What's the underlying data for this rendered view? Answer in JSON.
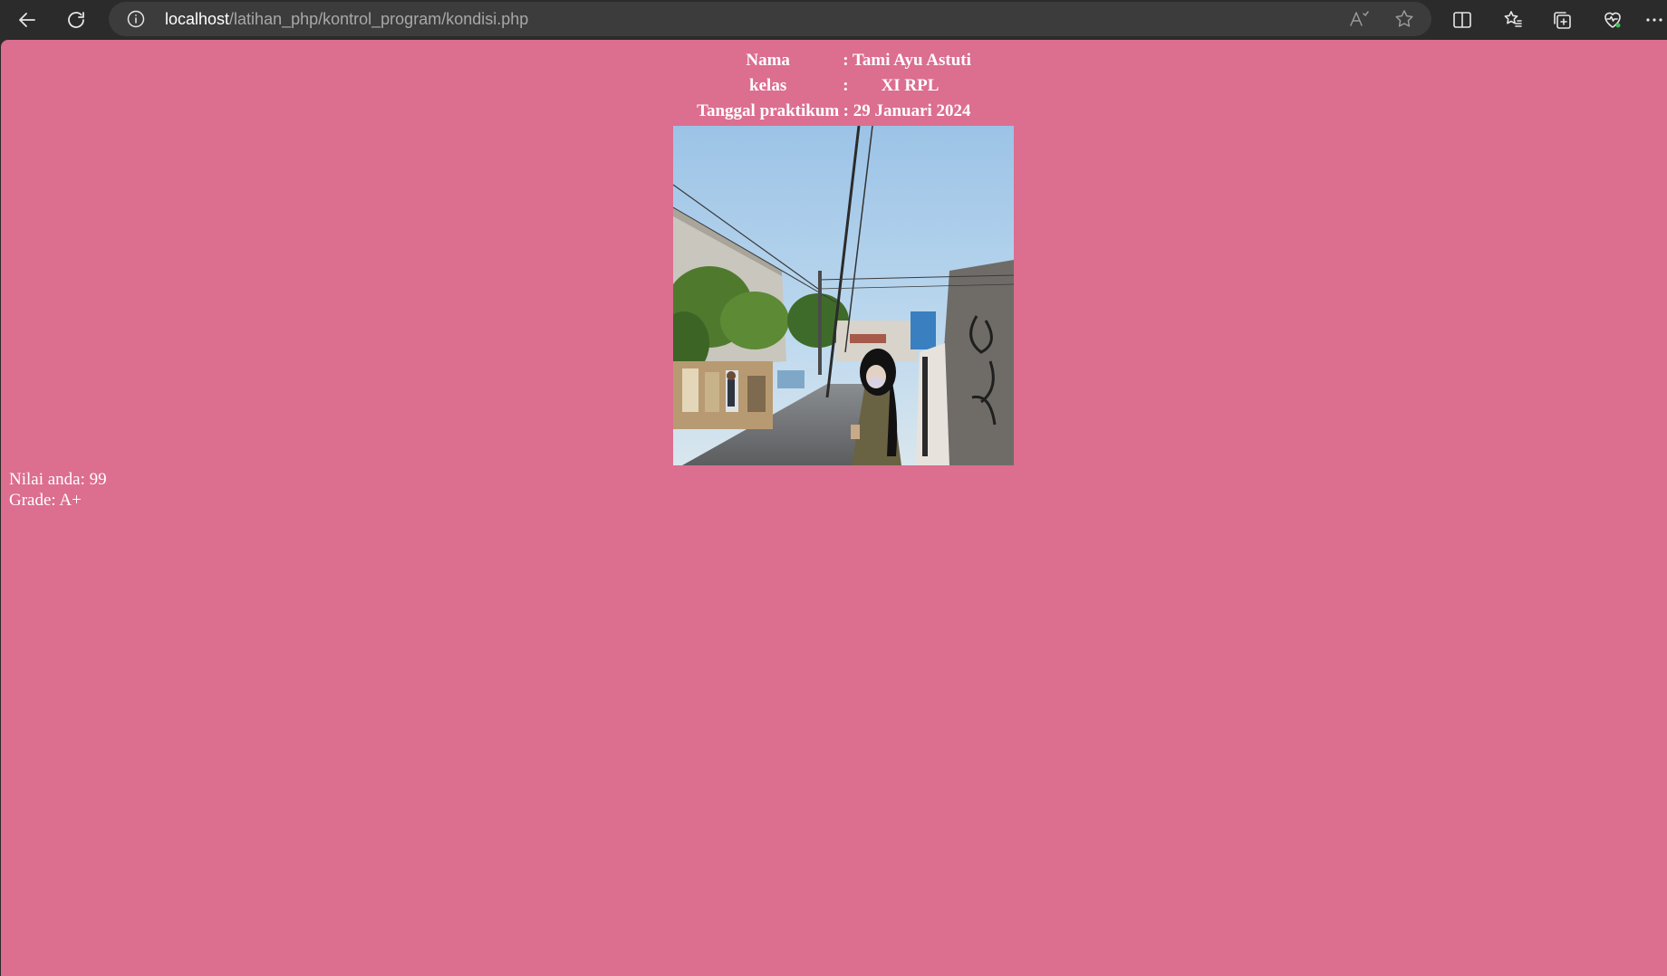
{
  "browser": {
    "url_host": "localhost",
    "url_path": "/latihan_php/kontrol_program/kondisi.php",
    "icons": [
      "back-icon",
      "refresh-icon",
      "info-icon",
      "read-aloud-icon",
      "favorite-star-icon",
      "split-screen-icon",
      "favorites-icon",
      "collections-icon",
      "browser-essentials-icon",
      "more-icon"
    ]
  },
  "identity": {
    "rows": [
      {
        "label": "Nama",
        "sep": ":",
        "value": "Tami Ayu Astuti"
      },
      {
        "label": "kelas",
        "sep": ":",
        "value": "XI RPL"
      },
      {
        "label": "Tanggal praktikum",
        "sep": ":",
        "value": "29 Januari 2024"
      }
    ]
  },
  "result": {
    "score_line": "Nilai anda: 99",
    "grade_line": "Grade: A+"
  },
  "colors": {
    "page_background": "#dc6e90",
    "chrome_background": "#2b2b2b",
    "text": "#ffffff"
  }
}
